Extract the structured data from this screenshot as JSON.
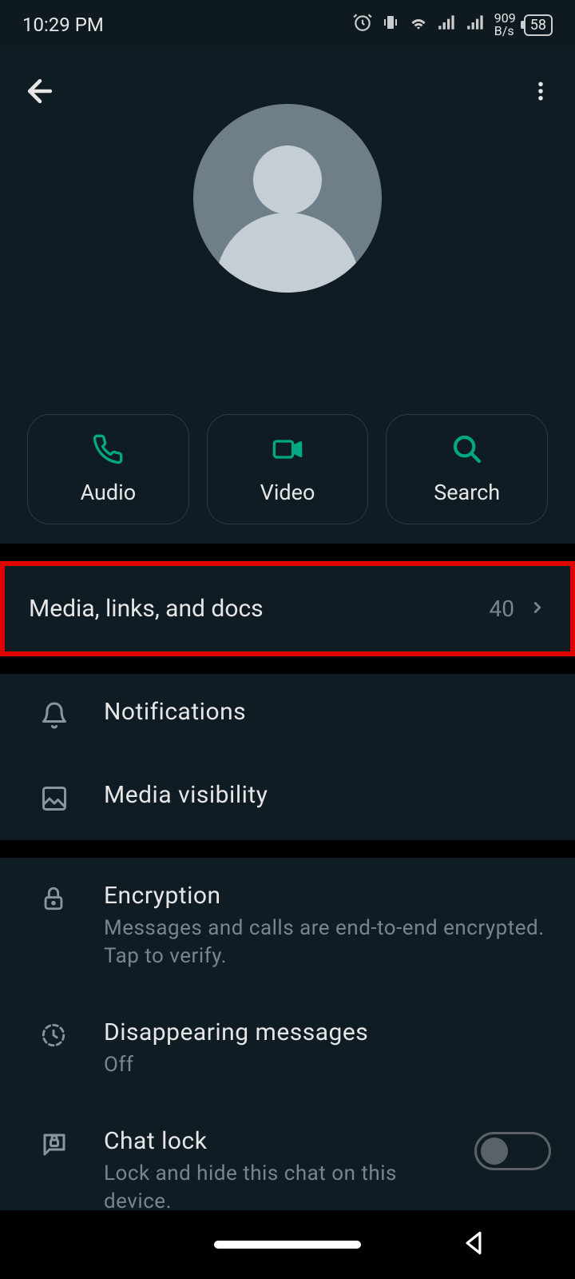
{
  "statusbar": {
    "time": "10:29 PM",
    "data_rate_top": "909",
    "data_rate_bottom": "B/s",
    "battery": "58"
  },
  "actions": {
    "audio": "Audio",
    "video": "Video",
    "search": "Search"
  },
  "media": {
    "title": "Media, links, and docs",
    "count": "40"
  },
  "settings": {
    "notifications": {
      "title": "Notifications"
    },
    "media_visibility": {
      "title": "Media visibility"
    },
    "encryption": {
      "title": "Encryption",
      "subtitle": "Messages and calls are end-to-end encrypted. Tap to verify."
    },
    "disappearing": {
      "title": "Disappearing messages",
      "subtitle": "Off"
    },
    "chat_lock": {
      "title": "Chat lock",
      "subtitle": "Lock and hide this chat on this device."
    }
  }
}
